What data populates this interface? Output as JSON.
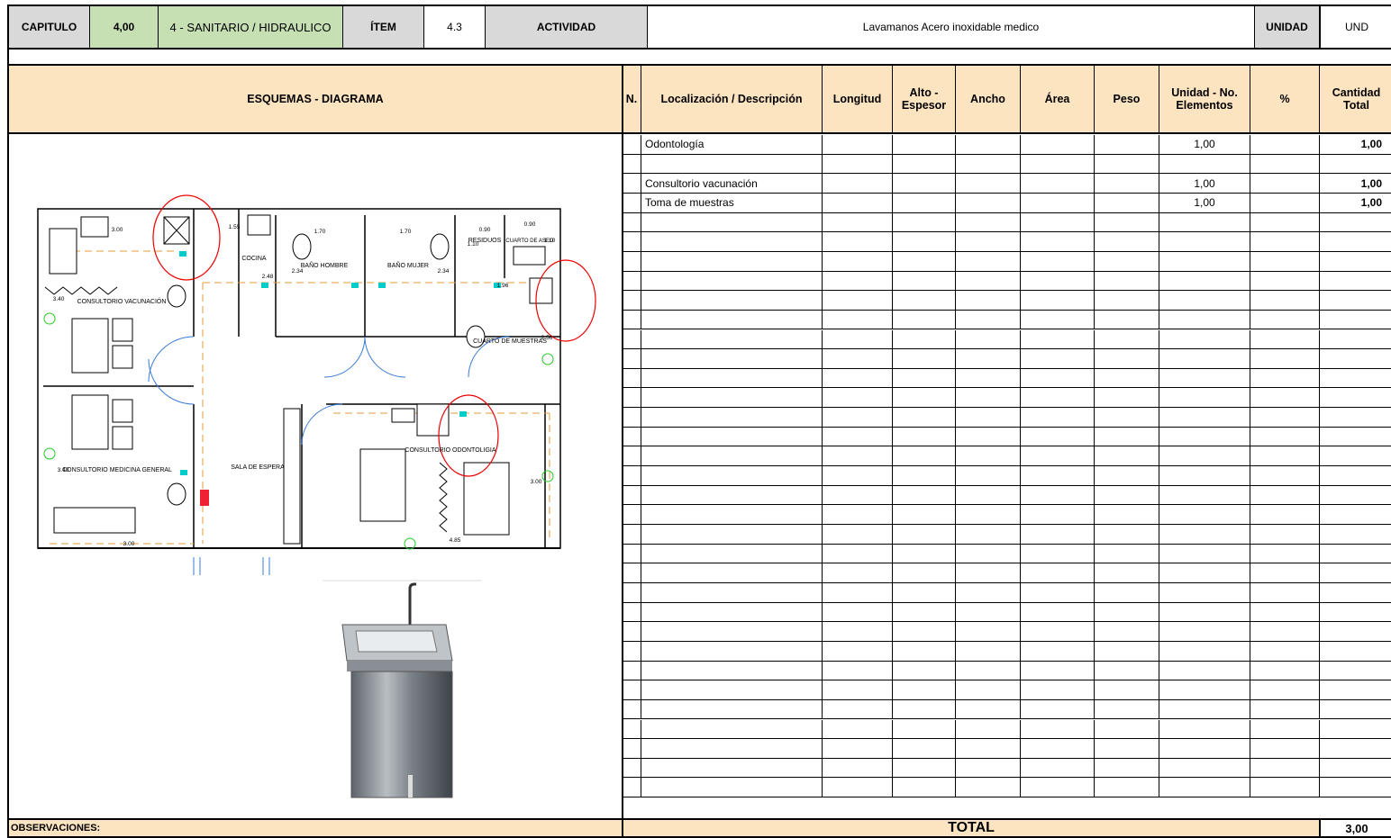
{
  "header": {
    "capitulo_label": "CAPITULO",
    "capitulo_value": "4,00",
    "capitulo_name": "4 - SANITARIO / HIDRAULICO",
    "item_label": "ÍTEM",
    "item_value": "4.3",
    "actividad_label": "ACTIVIDAD",
    "actividad_value": "Lavamanos Acero inoxidable medico",
    "unidad_label": "UNIDAD",
    "unidad_value": "UND"
  },
  "diagram": {
    "title": "ESQUEMAS - DIAGRAMA",
    "labels": {
      "consultorio_vacunacion": "CONSULTORIO VACUNACIÓN",
      "consultorio_medicina": "CONSULTORIO MEDICINA GENERAL",
      "cocina": "COCINA",
      "bano_hombre": "BAÑO HOMBRE",
      "bano_mujer": "BAÑO MUJER",
      "residuos": "RESIDUOS",
      "cuarto_aseo": "CUARTO DE ASEO",
      "cuarto_muestras": "CUARTO DE MUESTRAS",
      "sala_espera": "SALA DE ESPERA",
      "consultorio_odontologia": "CONSULTORIO ODONTOLIGIA",
      "dims": [
        "3.00",
        "1.55",
        "1.70",
        "1.70",
        "0.90",
        "0.90",
        "1.10",
        "1.10",
        "2.48",
        "2.34",
        "2.34",
        "3.40",
        "1.96",
        "2.56",
        "3.40",
        "3.00",
        "4.85",
        "3.00"
      ]
    }
  },
  "table": {
    "headers": {
      "n": "N.",
      "localizacion": "Localización / Descripción",
      "longitud": "Longitud",
      "alto": "Alto - Espesor",
      "ancho": "Ancho",
      "area": "Área",
      "peso": "Peso",
      "unidad_no": "Unidad - No. Elementos",
      "pct": "%",
      "cantidad": "Cantidad Total"
    },
    "rows": [
      {
        "desc": "Odontología",
        "unidad_no": "1,00",
        "cantidad": "1,00"
      },
      {
        "desc": "",
        "unidad_no": "",
        "cantidad": ""
      },
      {
        "desc": "Consultorio vacunación",
        "unidad_no": "1,00",
        "cantidad": "1,00"
      },
      {
        "desc": "Toma de muestras",
        "unidad_no": "1,00",
        "cantidad": "1,00"
      }
    ]
  },
  "footer": {
    "observaciones": "OBSERVACIONES:",
    "total_label": "TOTAL",
    "total_value": "3,00"
  }
}
